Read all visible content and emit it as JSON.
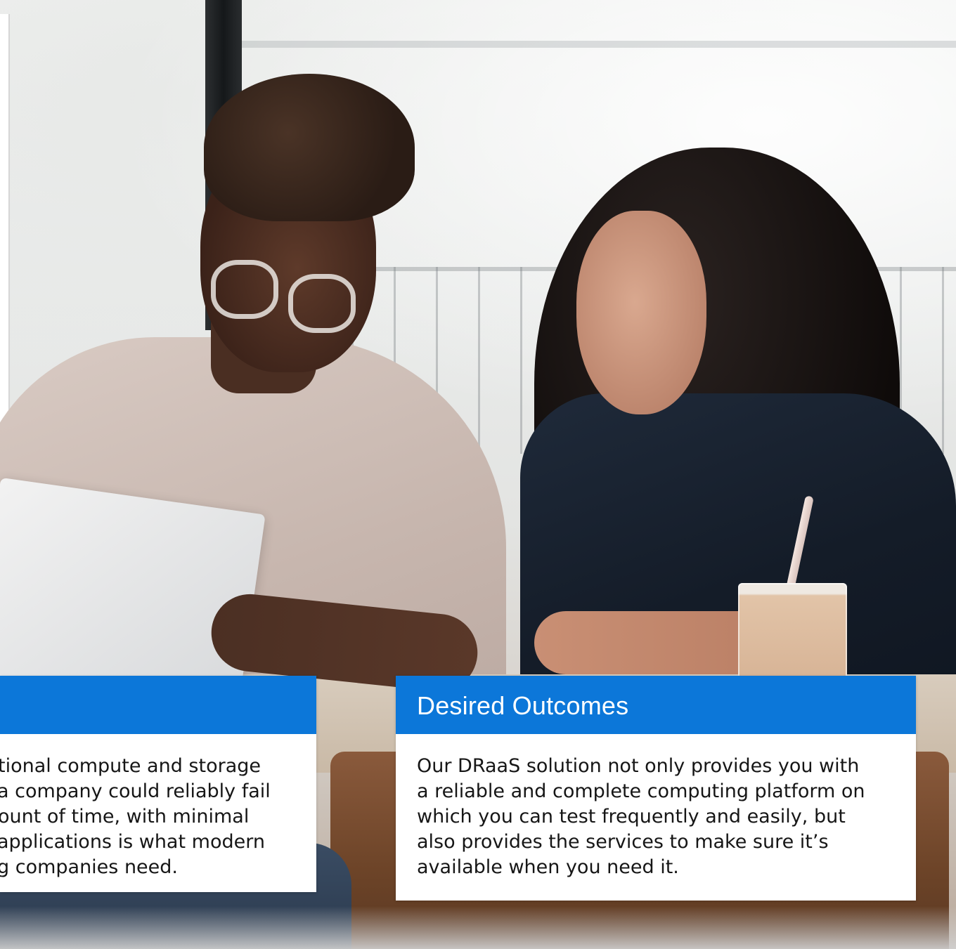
{
  "background_photo": {
    "description_icon": "people-meeting-photo"
  },
  "left_card": {
    "header": "",
    "lines": [
      "tional compute and storage",
      "a company could reliably fail",
      "ount of time, with minimal",
      "applications is what modern",
      "g companies need."
    ]
  },
  "right_card": {
    "header": "Desired Outcomes",
    "lines": [
      "Our DRaaS solution not only provides you with",
      "a reliable and complete computing platform on",
      "which you can test frequently and easily, but",
      "also provides the services to make sure it’s",
      "available when you need it."
    ]
  },
  "colors": {
    "header_blue": "#0c77d9",
    "card_bg": "#ffffff",
    "body_text": "#161616"
  }
}
